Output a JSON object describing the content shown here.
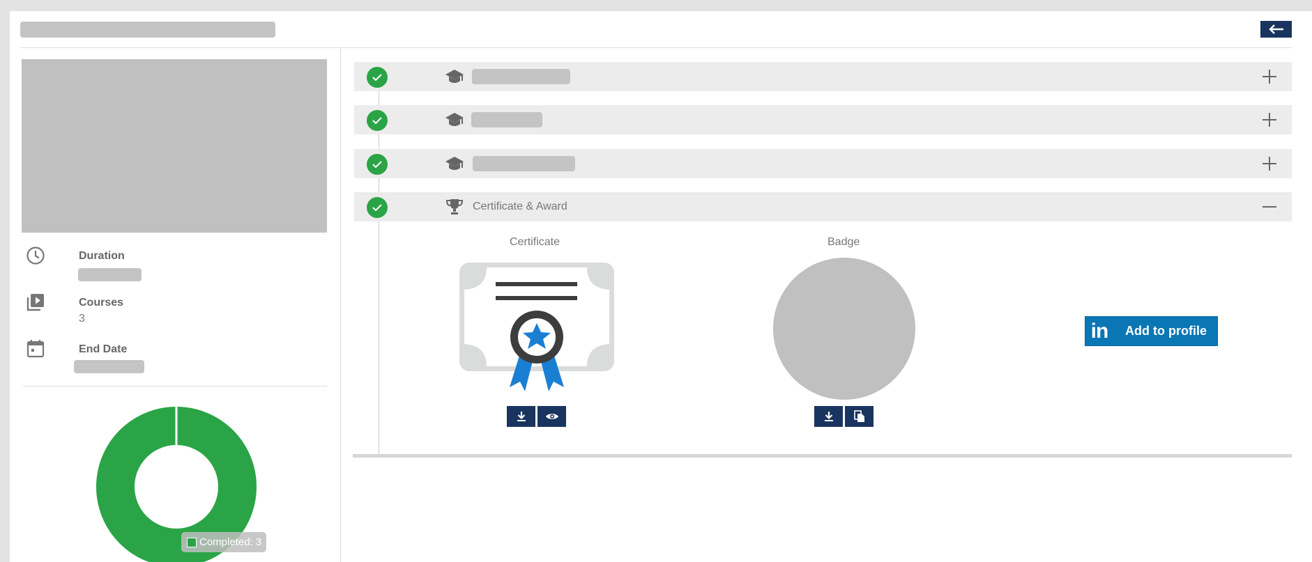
{
  "header": {
    "back_icon": "arrow-left-icon"
  },
  "sidebar": {
    "duration": {
      "label": "Duration",
      "icon": "clock-icon"
    },
    "courses": {
      "label": "Courses",
      "value": "3",
      "icon": "video-library-icon"
    },
    "end_date": {
      "label": "End Date",
      "icon": "calendar-icon"
    },
    "chart_tooltip": "Completed: 3"
  },
  "chart_data": {
    "type": "pie",
    "categories": [
      "Completed"
    ],
    "values": [
      3
    ],
    "total": 3,
    "colors": [
      "#2aa446"
    ]
  },
  "timeline": {
    "items": [
      {
        "status": "completed",
        "icon": "graduation-cap-icon",
        "expanded": false
      },
      {
        "status": "completed",
        "icon": "graduation-cap-icon",
        "expanded": false
      },
      {
        "status": "completed",
        "icon": "graduation-cap-icon",
        "expanded": false
      },
      {
        "status": "completed",
        "icon": "trophy-icon",
        "label": "Certificate & Award",
        "expanded": true
      }
    ]
  },
  "award": {
    "certificate_label": "Certificate",
    "badge_label": "Badge",
    "linkedin_logo": "in",
    "linkedin_label": "Add to profile"
  },
  "colors": {
    "accent": "#1a3460",
    "success": "#2aa446",
    "linkedin": "#0a76b3"
  }
}
